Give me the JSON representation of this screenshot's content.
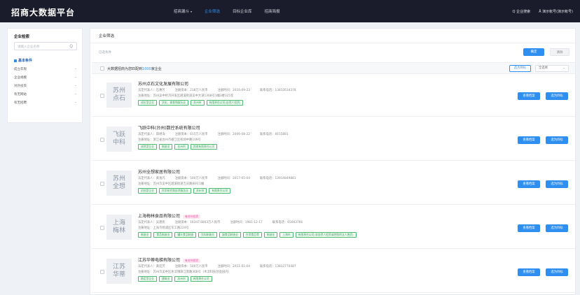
{
  "app": {
    "title": "招商大数据平台"
  },
  "nav": {
    "items": [
      {
        "label": "招商漏斗",
        "dropdown": "▾",
        "active": false
      },
      {
        "label": "企业筛选",
        "active": true
      },
      {
        "label": "目标企业库",
        "active": false
      },
      {
        "label": "招商简报",
        "active": false
      }
    ]
  },
  "top_right": {
    "search_label": "Q 企业搜索",
    "user_label": "Å 演示帐号(演示帐号)"
  },
  "sidebar": {
    "title": "企业检索",
    "search_placeholder": "请输入企业名称",
    "search_icon": "Q",
    "section_label": "基本条件",
    "items": [
      {
        "label": "成立年限"
      },
      {
        "label": "企业规模"
      },
      {
        "label": "对外投资"
      },
      {
        "label": "有无网站"
      },
      {
        "label": "有无招聘"
      }
    ]
  },
  "main": {
    "title": "企业筛选",
    "filter_label": "已选条件",
    "confirm_label": "确定",
    "clear_label": "清除",
    "summary": {
      "prefix": "大数据招商为您匹配到",
      "count": "1000",
      "suffix": "家企业"
    },
    "batch_target_label": "选为目标",
    "select_all_label": "全选择",
    "select_arrow": "⌄",
    "view_label": "查看档案",
    "target_label": "选为目标"
  },
  "companies": [
    {
      "logo_line1": "苏州",
      "logo_line2": "点石",
      "name": "苏州点石文化发展有限公司",
      "badge": "",
      "legal": "法定代表人：石惠芳",
      "capital": "注册资本：218万人民币",
      "date": "注册时间：2016-09-23",
      "phone": "联系电话：13812634378",
      "address": "注册地址：苏州吴中经济开发区越溪街道吴中大道1368号1幢3楼325室",
      "tags": [
        "成长型企业",
        "文化、体育和娱乐业",
        "苏州市",
        "有限责任公司(自然人投资)"
      ]
    },
    {
      "logo_line1": "飞跃",
      "logo_line2": "中科",
      "name": "飞跃中科(台州)数控系统有限公司",
      "badge": "",
      "legal": "法定代表人：邱继海",
      "capital": "注册资本：615万人民币",
      "date": "注册时间：2006-08-22",
      "phone": "联系电话：8155881",
      "address": "注册地址：浙江省台州市椒江区机场中路109号",
      "tags": [
        "成熟型企业",
        "制造业",
        "台州市",
        "其他有限责任公司"
      ]
    },
    {
      "logo_line1": "苏州",
      "logo_line2": "全想",
      "name": "苏州全想家居有限公司",
      "badge": "",
      "legal": "法定代表人：黄逸凡",
      "capital": "注册资本：500万人民币",
      "date": "注册时间：2017-05-04",
      "phone": "联系电话：13914849881",
      "address": "注册地址：苏州市吴中区越溪街道吉庆路88号1幢",
      "tags": [
        "初创型企业",
        "科学研究和技术服务业",
        "苏州市",
        "有限责任公司"
      ]
    },
    {
      "logo_line1": "上海",
      "logo_line2": "梅林",
      "name": "上海梅林食品有限公司",
      "badge": "有对外投资",
      "legal": "法定代表人：吴建民",
      "capital": "注册资本：16347.6803万人民币",
      "date": "注册时间：1981-12-17",
      "phone": "联系电话：65663766",
      "address": "注册地址：上海市杨浦区军工路224号",
      "tags": [
        "制造业",
        "食品制造业",
        "罐头食品制造",
        "饮料制造业",
        "副食品制造业",
        "台资食品等",
        "制造业",
        "上海市",
        "有限责任公司(非自然人投资或控股的法人独资)"
      ]
    },
    {
      "logo_line1": "江苏",
      "logo_line2": "华蒂",
      "name": "江苏华蒂电梯有限公司",
      "badge": "有对外投资",
      "legal": "法定代表人：黄廷芳",
      "capital": "注册资本：500万人民币",
      "date": "注册时间：2011-01-04",
      "phone": "联系电话：13812770487",
      "address": "注册地址：苏州市吴中区木渎镇珠江南路368号（木渎科技创业园内）",
      "tags": [
        "稳定型企业",
        "建筑业",
        "苏州市",
        "有限责任公司"
      ]
    }
  ]
}
